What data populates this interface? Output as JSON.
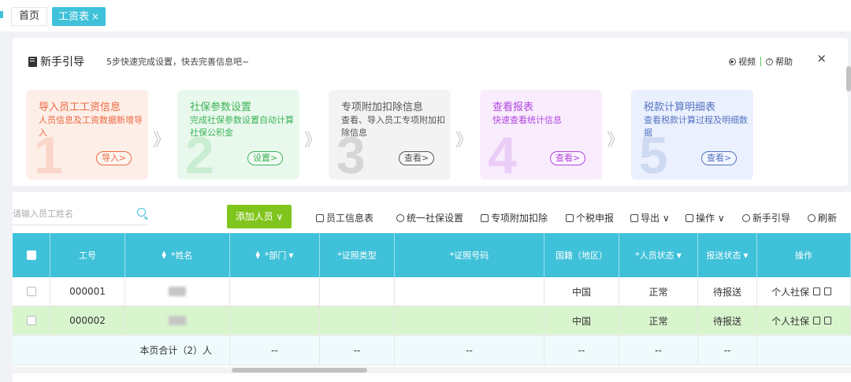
{
  "tabs": [
    {
      "label": "首页"
    },
    {
      "label": "工资表",
      "close": "×"
    }
  ],
  "guide": {
    "title": "新手引导",
    "subtitle": "5步快速完成设置，快去完善信息吧~",
    "video_label": "视频",
    "help_label": "帮助",
    "close": "×",
    "steps": [
      {
        "title": "导入员工工资信息",
        "desc": "人员信息及工资数据新增导入",
        "num": "1",
        "button": "导入>",
        "color": "#ec6940"
      },
      {
        "title": "社保参数设置",
        "desc": "完成社保参数设置自动计算社保公积金",
        "num": "2",
        "button": "设置>",
        "color": "#3db55a"
      },
      {
        "title": "专项附加扣除信息",
        "desc": "查看、导入员工专项附加扣除信息",
        "num": "3",
        "button": "查看>",
        "color": "#555555"
      },
      {
        "title": "查看报表",
        "desc": "快速查看统计信息",
        "num": "4",
        "button": "查看>",
        "color": "#b347e0"
      },
      {
        "title": "税款计算明细表",
        "desc": "查看税款计算过程及明细数据",
        "num": "5",
        "button": "查看>",
        "color": "#5573c4"
      }
    ],
    "arrow": "》"
  },
  "toolbar": {
    "search_placeholder": "请输入员工姓名",
    "add_button": "添加人员 ∨",
    "tools": [
      "员工信息表",
      "统一社保设置",
      "专项附加扣除",
      "个税申报",
      "导出 ∨",
      "操作 ∨",
      "新手引导",
      "刷新"
    ]
  },
  "table": {
    "headers": [
      "工号",
      "*姓名",
      "*部门",
      "*证照类型",
      "*证照号码",
      "国籍（地区）",
      "*人员状态",
      "报送状态",
      "操作"
    ],
    "rows": [
      {
        "id": "000001",
        "dept": "",
        "id_type": "",
        "id_no": "",
        "nation": "中国",
        "status": "正常",
        "report": "待报送",
        "op": "个人社保"
      },
      {
        "id": "000002",
        "dept": "",
        "id_type": "",
        "id_no": "",
        "nation": "中国",
        "status": "正常",
        "report": "待报送",
        "op": "个人社保"
      }
    ],
    "total_label": "本页合计（2）人",
    "total_placeholder": "--"
  },
  "colors": {
    "accent": "#3fc1d9",
    "add_button": "#80c51e",
    "selected_row": "#d9f5ce"
  }
}
